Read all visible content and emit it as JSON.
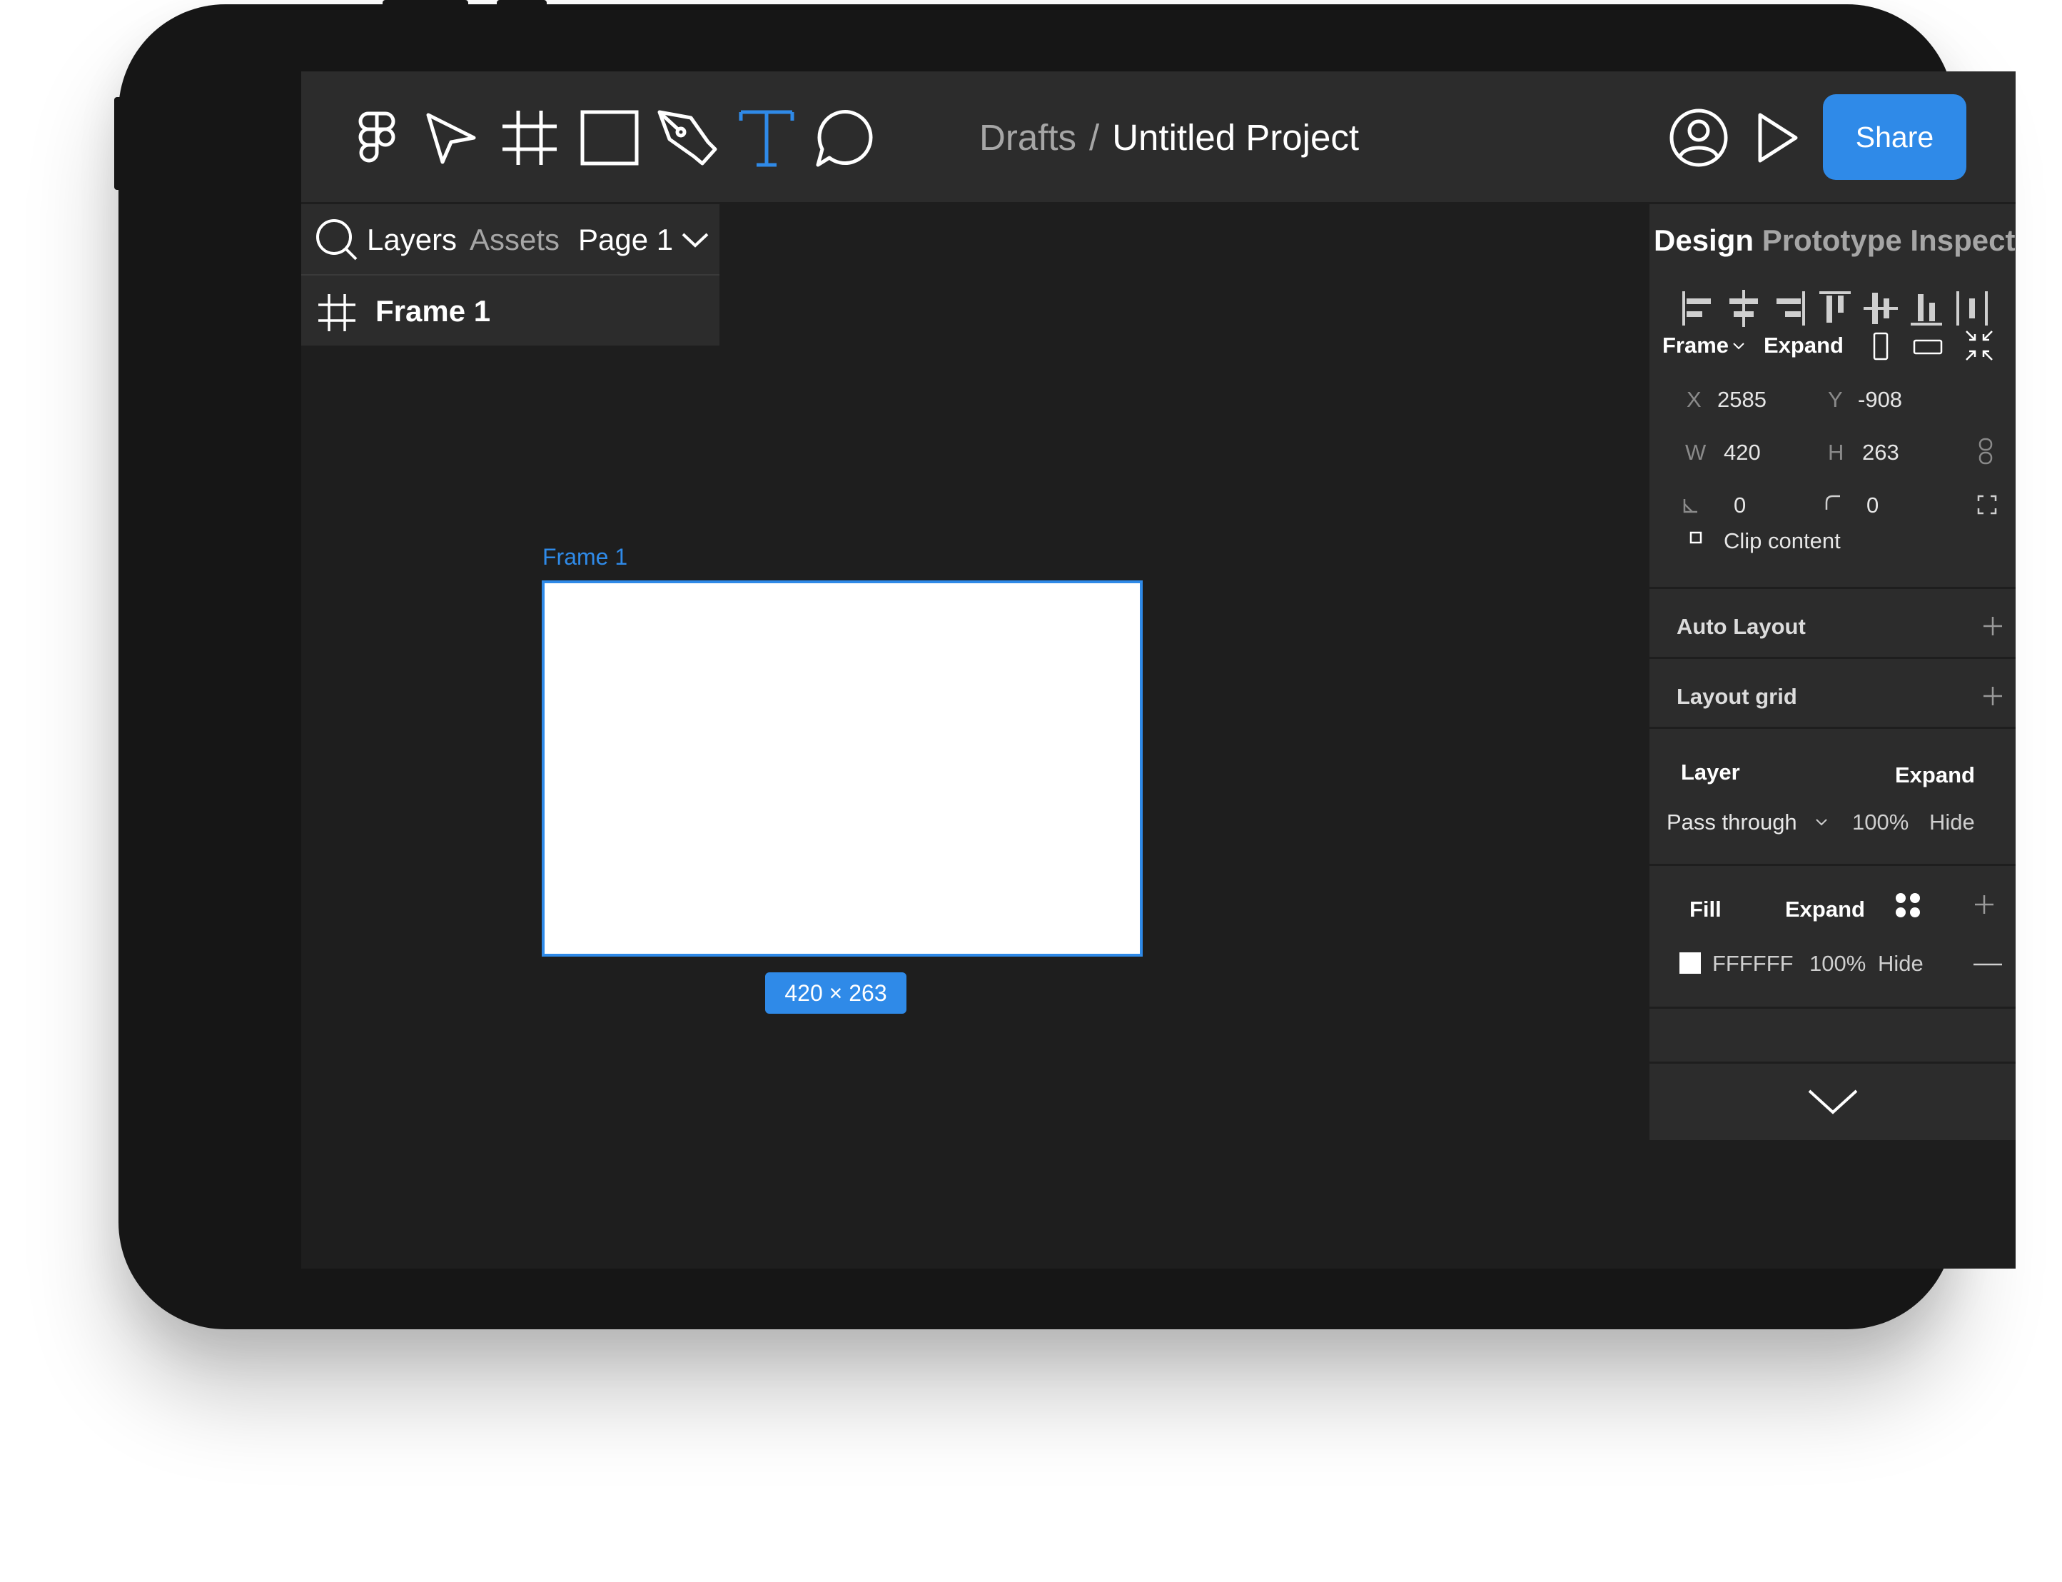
{
  "toolbar": {
    "tools": [
      "figma-logo",
      "move",
      "frame",
      "rectangle",
      "pen",
      "text",
      "comment"
    ],
    "breadcrumb_parent": "Drafts",
    "breadcrumb_separator": "/",
    "project_title": "Untitled Project",
    "share_label": "Share",
    "accent": "#2F8AE8"
  },
  "left_panel": {
    "tabs": {
      "layers": "Layers",
      "assets": "Assets",
      "page": "Page 1"
    },
    "layers": [
      {
        "name": "Frame 1",
        "type": "frame"
      }
    ]
  },
  "canvas": {
    "frame_label": "Frame 1",
    "size_badge": "420 × 263",
    "frame_fill": "#FFFFFF",
    "background": "#1E1E1E"
  },
  "right_panel": {
    "tabs": {
      "design": "Design",
      "prototype": "Prototype",
      "inspect": "Inspect"
    },
    "frame": {
      "label": "Frame",
      "expand": "Expand",
      "x_label": "X",
      "x": "2585",
      "y_label": "Y",
      "y": "-908",
      "w_label": "W",
      "w": "420",
      "h_label": "H",
      "h": "263",
      "rotation": "0",
      "radius": "0",
      "clip_content": "Clip content"
    },
    "auto_layout": "Auto Layout",
    "layout_grid": "Layout grid",
    "layer": {
      "title": "Layer",
      "expand": "Expand",
      "blend": "Pass through",
      "opacity": "100%",
      "hide": "Hide"
    },
    "fill": {
      "title": "Fill",
      "expand": "Expand",
      "hex": "FFFFFF",
      "opacity": "100%",
      "hide": "Hide"
    }
  }
}
